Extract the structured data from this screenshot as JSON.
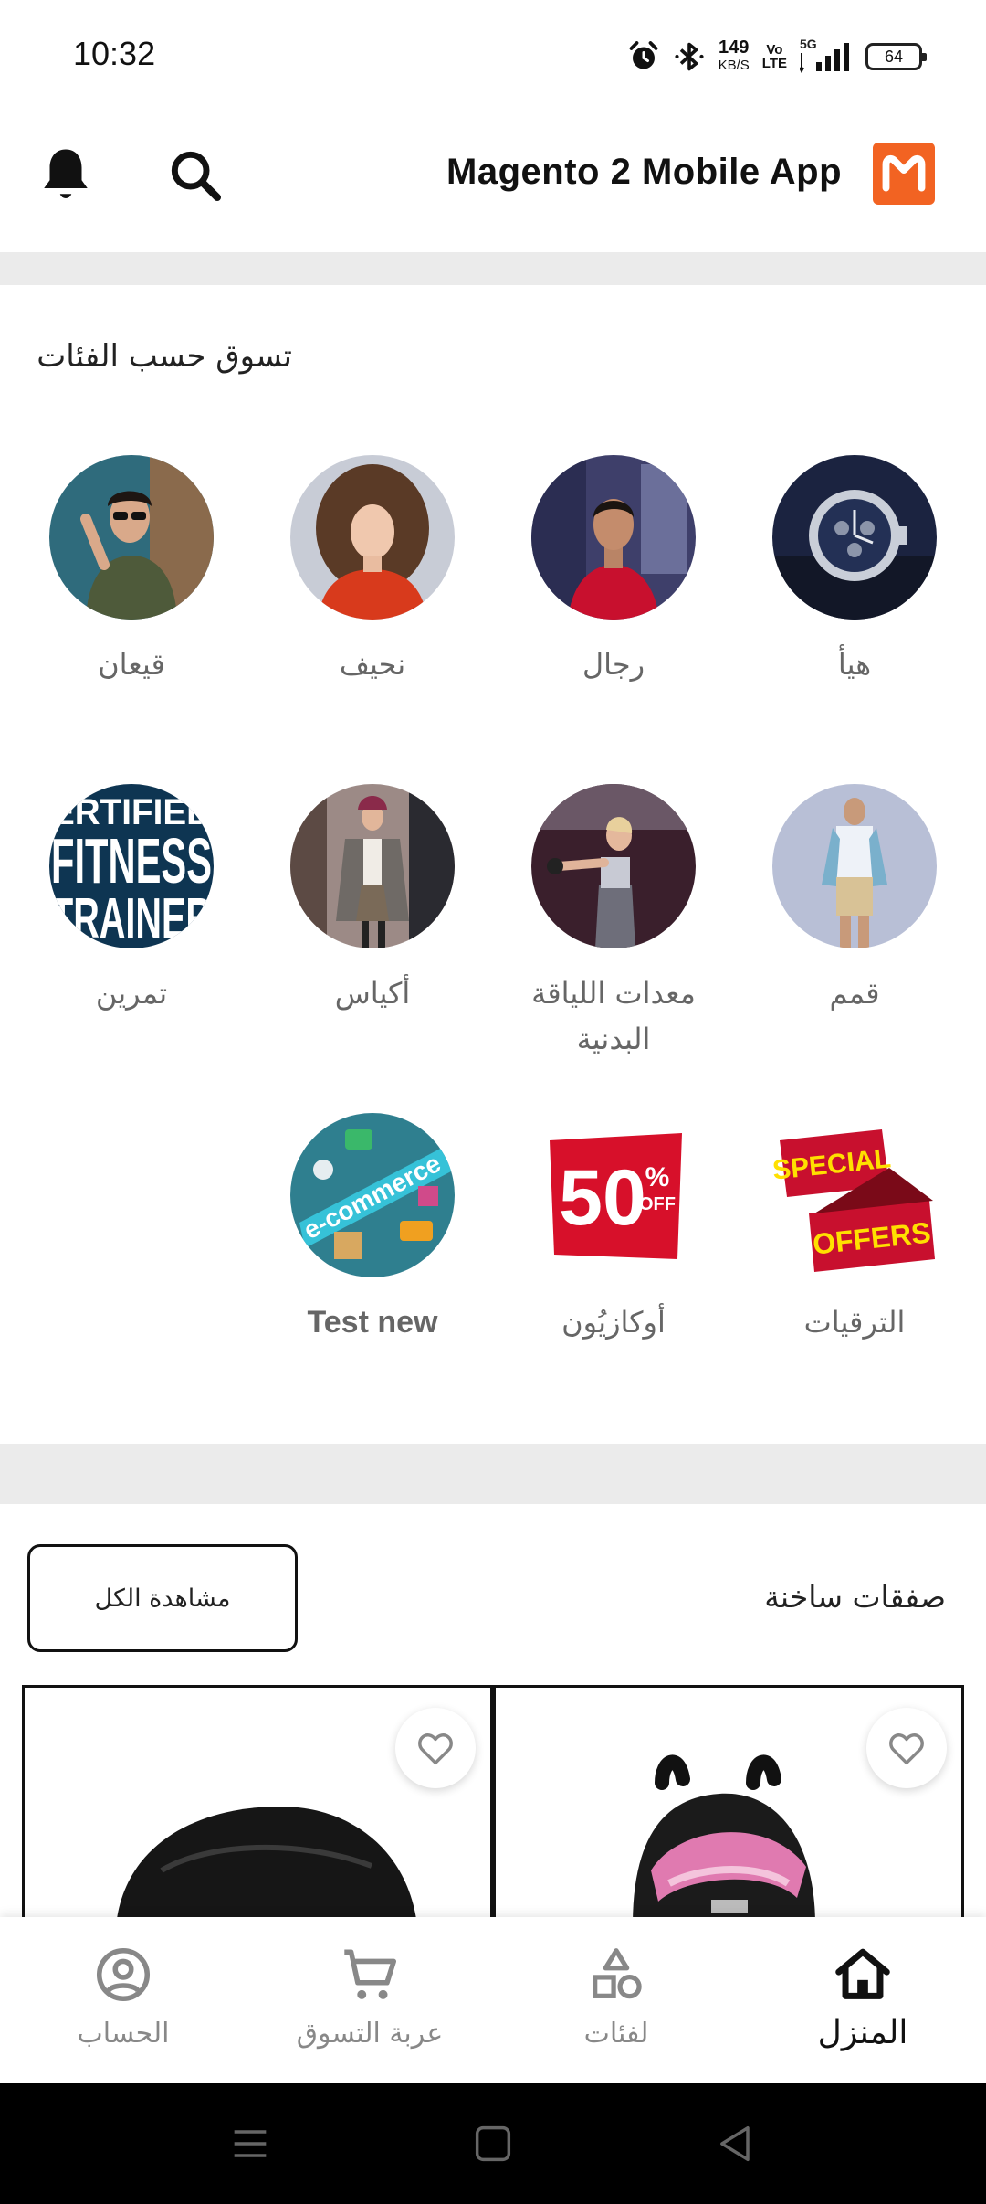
{
  "status_bar": {
    "time": "10:32",
    "speed_value": "149",
    "speed_unit": "KB/S",
    "volte_top": "Vo",
    "volte_bottom": "LTE",
    "network": "5G",
    "battery": "64",
    "icons": [
      "alarm-icon",
      "bluetooth-icon",
      "signal-icon",
      "battery-icon"
    ]
  },
  "header": {
    "title": "Magento 2 Mobile App",
    "icons": [
      "bell-icon",
      "search-icon",
      "magento-logo"
    ],
    "logo_color": "#f26322"
  },
  "categories": {
    "title": "تسوق حسب الفئات",
    "items": [
      {
        "label": "هيأ"
      },
      {
        "label": "رجال"
      },
      {
        "label": "نحيف"
      },
      {
        "label": "قيعان"
      },
      {
        "label": "قمم"
      },
      {
        "label": "معدات اللياقة البدنية"
      },
      {
        "label": "أكياس"
      },
      {
        "label": "تمرين",
        "image_text": [
          "ERTIFIED",
          "FITNESS",
          "TRAINER"
        ]
      },
      {
        "label": "الترقيات",
        "image_text": [
          "SPECIAL",
          "OFFERS"
        ]
      },
      {
        "label": "أوكازيُون",
        "image_text": [
          "50",
          "%",
          "OFF"
        ]
      },
      {
        "label": "Test new",
        "image_text": [
          "e-commerce"
        ]
      }
    ]
  },
  "deals": {
    "title": "صفقات ساخنة",
    "view_all": "مشاهدة الكل"
  },
  "bottom_nav": {
    "items": [
      {
        "label": "المنزل",
        "icon": "home-icon",
        "active": true
      },
      {
        "label": "لفئات",
        "icon": "shapes-icon",
        "active": false
      },
      {
        "label": "عربة التسوق",
        "icon": "cart-icon",
        "active": false
      },
      {
        "label": "الحساب",
        "icon": "account-icon",
        "active": false
      }
    ]
  },
  "system_nav": {
    "icons": [
      "menu-icon",
      "home-square-icon",
      "back-icon"
    ]
  }
}
